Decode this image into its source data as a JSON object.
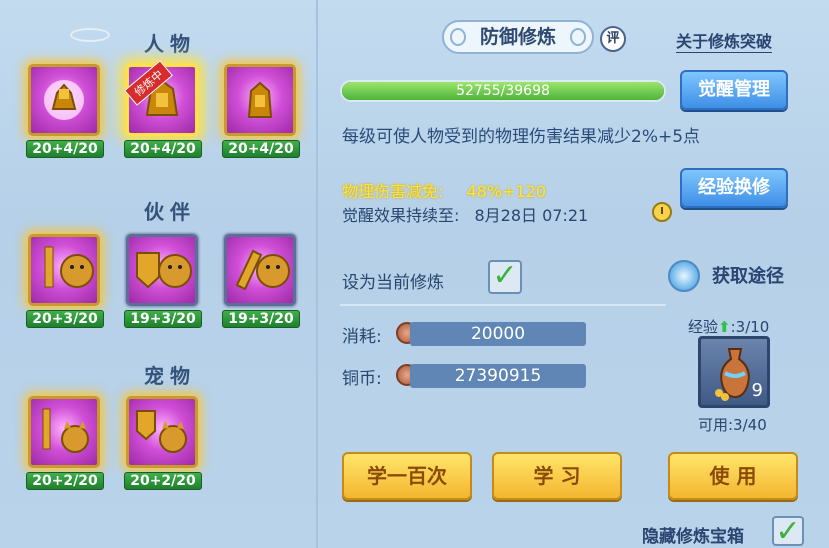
{
  "sections": {
    "person": "人物",
    "partner": "伙伴",
    "pet": "宠物"
  },
  "person_slots": [
    {
      "level": "20+4/20",
      "badge": ""
    },
    {
      "level": "20+4/20",
      "badge": "修炼中"
    },
    {
      "level": "20+4/20",
      "badge": ""
    }
  ],
  "partner_slots": [
    {
      "level": "20+3/20"
    },
    {
      "level": "19+3/20"
    },
    {
      "level": "19+3/20"
    }
  ],
  "pet_slots": [
    {
      "level": "20+2/20"
    },
    {
      "level": "20+2/20"
    }
  ],
  "header": {
    "title": "防御修炼",
    "rate_badge": "评",
    "about_link": "关于修炼突破"
  },
  "progress": {
    "text": "52755/39698",
    "fraction": 1.0
  },
  "buttons": {
    "awaken_manage": "觉醒管理",
    "exp_exchange": "经验换修",
    "learn_hundred": "学一百次",
    "learn": "学 习",
    "use": "使 用"
  },
  "description": "每级可使人物受到的物理伤害结果减少2%+5点",
  "stats": {
    "reduction_label": "物理伤害减免:",
    "reduction_value": "48%+120",
    "duration_label": "觉醒效果持续至:",
    "duration_value": "8月28日 07:21"
  },
  "set_current": {
    "label": "设为当前修炼",
    "checked": true
  },
  "obtain": "获取途径",
  "cost": {
    "consume_label": "消耗:",
    "consume_value": "20000",
    "copper_label": "铜币:",
    "copper_value": "27390915"
  },
  "item": {
    "exp_label": "经验",
    "exp_value": ":3/10",
    "count": "9",
    "usable": "可用:3/40"
  },
  "hide_chest": {
    "label": "隐藏修炼宝箱",
    "checked": true
  },
  "colors": {
    "panel_bg": "#b7d2ea",
    "accent_blue": "#3e8fe6",
    "gold_button": "#f4b630",
    "highlight_yellow": "#ffe43a",
    "progress_green": "#4fb33c"
  }
}
